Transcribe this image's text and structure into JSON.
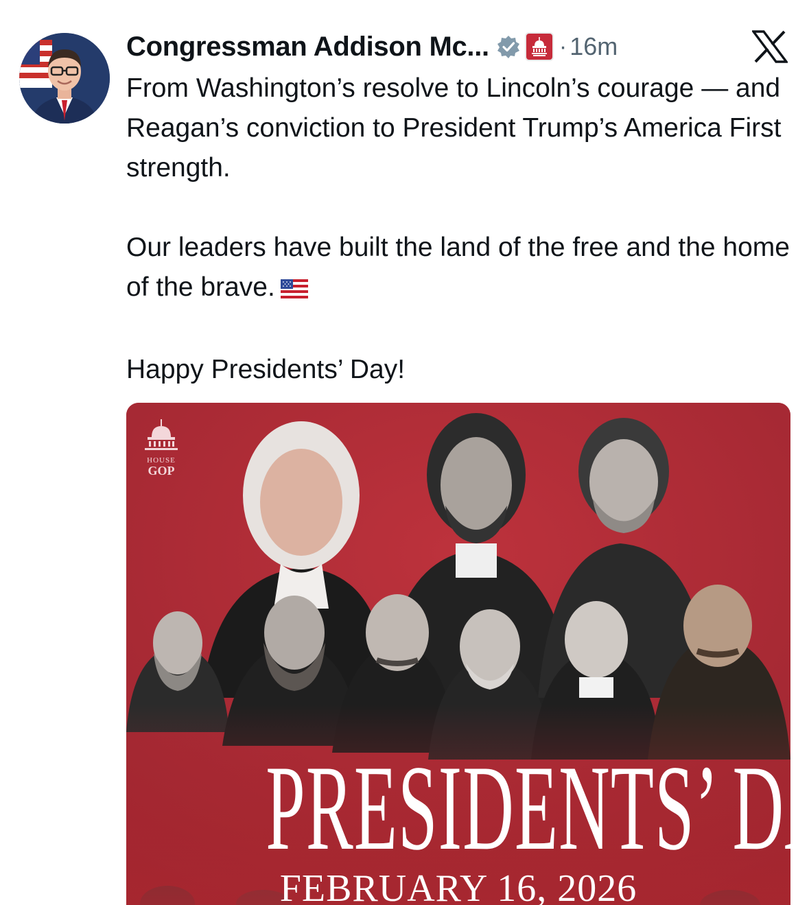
{
  "tweet": {
    "author_name": "Congressman Addison Mc...",
    "separator": "·",
    "timestamp": "16m",
    "paragraphs": [
      "From Washington’s resolve to Lincoln’s courage — and Reagan’s conviction to President Trump’s America First strength.",
      "Our leaders have built the land of the free and the home of the brave.",
      "Happy Presidents’ Day!"
    ]
  },
  "badges": {
    "verified_color": "#829aab",
    "affiliate_color": "#c62b3a"
  },
  "media": {
    "logo_line1": "HOUSE",
    "logo_line2": "GOP",
    "title": "PRESIDENTS’ DAY",
    "date": "FEBRUARY 16, 2026",
    "background_color": "#b02a33"
  },
  "icons": {
    "close": "x-logo-icon",
    "emoji": "us-flag-emoji"
  }
}
